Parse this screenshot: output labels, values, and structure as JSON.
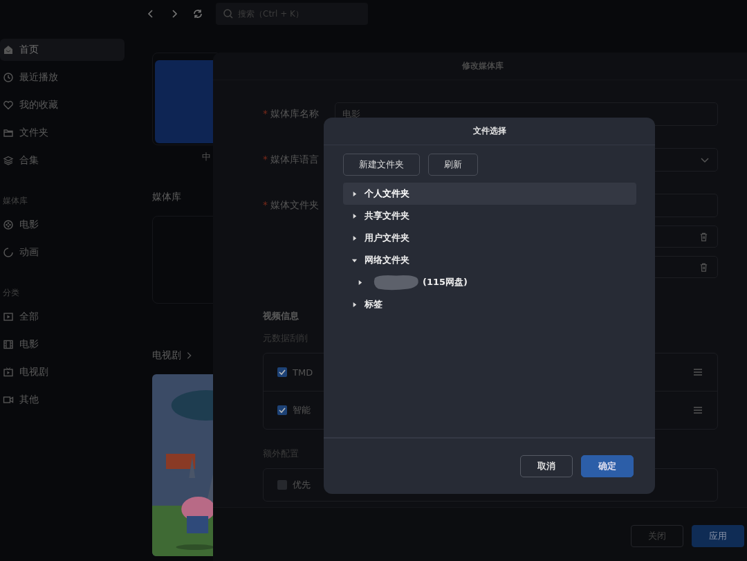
{
  "topbar": {
    "search": {
      "placeholder": "搜索（Ctrl + K）"
    }
  },
  "sidebar": {
    "groups": [
      {
        "items": [
          {
            "label": "首页",
            "selected": true
          },
          {
            "label": "最近播放",
            "selected": false
          },
          {
            "label": "我的收藏",
            "selected": false
          },
          {
            "label": "文件夹",
            "selected": false
          },
          {
            "label": "合集",
            "selected": false
          }
        ]
      },
      {
        "title": "媒体库",
        "items": [
          {
            "label": "电影",
            "selected": false
          },
          {
            "label": "动画",
            "selected": false
          }
        ]
      },
      {
        "title": "分类",
        "items": [
          {
            "label": "全部",
            "selected": false
          },
          {
            "label": "电影",
            "selected": false
          },
          {
            "label": "电视剧",
            "selected": false
          },
          {
            "label": "其他",
            "selected": false
          }
        ]
      }
    ]
  },
  "main": {
    "first_card_caption": "中",
    "library_heading": "媒体库",
    "tv_heading": "电视剧"
  },
  "edit_dialog": {
    "title": "修改媒体库",
    "fields": [
      {
        "label": "媒体库名称",
        "marker": "*",
        "value": "电影",
        "kind": "input"
      },
      {
        "label": "媒体库语言",
        "marker": "*",
        "kind": "select"
      },
      {
        "label": "媒体文件夹",
        "marker": "*",
        "kind": "input"
      }
    ],
    "folder_rows": [
      {
        "kind": "path"
      },
      {
        "kind": "path"
      }
    ],
    "video_info": {
      "title": "视频信息",
      "subtitle": "元数据刮削",
      "scrapers": [
        {
          "label": "TMD",
          "checked": true
        },
        {
          "label": "智能",
          "checked": true
        }
      ]
    },
    "extra": {
      "title": "额外配置",
      "options": [
        {
          "label": "优先",
          "checked": false
        }
      ]
    },
    "buttons": [
      {
        "label": "关闭",
        "primary": false
      },
      {
        "label": "应用",
        "primary": true
      }
    ]
  },
  "file_dialog": {
    "title": "文件选择",
    "toolbar": [
      "新建文件夹",
      "刷新"
    ],
    "tree": [
      {
        "label": "个人文件夹",
        "expanded": false,
        "selected": true
      },
      {
        "label": "共享文件夹",
        "expanded": false,
        "selected": false
      },
      {
        "label": "用户文件夹",
        "expanded": false,
        "selected": false
      },
      {
        "label": "网络文件夹",
        "expanded": true,
        "selected": false,
        "children": [
          {
            "label": "(115网盘)",
            "redacted": true,
            "expanded": false,
            "selected": false
          }
        ]
      },
      {
        "label": "标签",
        "expanded": false,
        "selected": false
      }
    ],
    "buttons": [
      {
        "label": "取消",
        "primary": false
      },
      {
        "label": "确定",
        "primary": true
      }
    ]
  }
}
